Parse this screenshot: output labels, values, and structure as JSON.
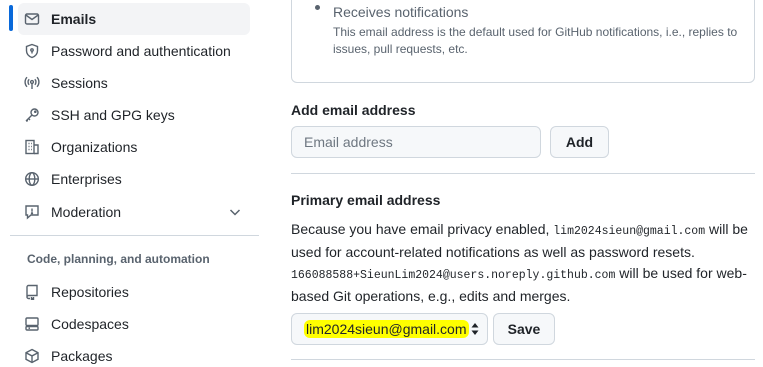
{
  "sidebar": {
    "items": [
      {
        "label": "Emails",
        "icon": "mail-icon"
      },
      {
        "label": "Password and authentication",
        "icon": "shield-lock-icon"
      },
      {
        "label": "Sessions",
        "icon": "broadcast-icon"
      },
      {
        "label": "SSH and GPG keys",
        "icon": "key-icon"
      },
      {
        "label": "Organizations",
        "icon": "organization-icon"
      },
      {
        "label": "Enterprises",
        "icon": "globe-icon"
      },
      {
        "label": "Moderation",
        "icon": "report-icon"
      }
    ],
    "section_heading": "Code, planning, and automation",
    "section_items": [
      {
        "label": "Repositories",
        "icon": "repo-icon"
      },
      {
        "label": "Codespaces",
        "icon": "codespaces-icon"
      },
      {
        "label": "Packages",
        "icon": "package-icon"
      }
    ]
  },
  "main": {
    "receives_title": "Receives notifications",
    "receives_desc": "This email address is the default used for GitHub notifications, i.e., replies to issues, pull requests, etc.",
    "add_email": {
      "heading": "Add email address",
      "placeholder": "Email address",
      "button": "Add"
    },
    "primary": {
      "heading": "Primary email address",
      "text_1": "Because you have email privacy enabled, ",
      "email_1": "lim2024sieun@gmail.com",
      "text_2": " will be used for account-related notifications as well as password resets. ",
      "email_2": "166088588+SieunLim2024@users.noreply.github.com",
      "text_3": " will be used for web-based Git operations, e.g., edits and merges.",
      "selected": "lim2024sieun@gmail.com",
      "button": "Save"
    }
  },
  "colors": {
    "accent": "#0969da",
    "highlight": "#ffff00",
    "border": "#d0d7de",
    "muted_text": "#59636e"
  }
}
